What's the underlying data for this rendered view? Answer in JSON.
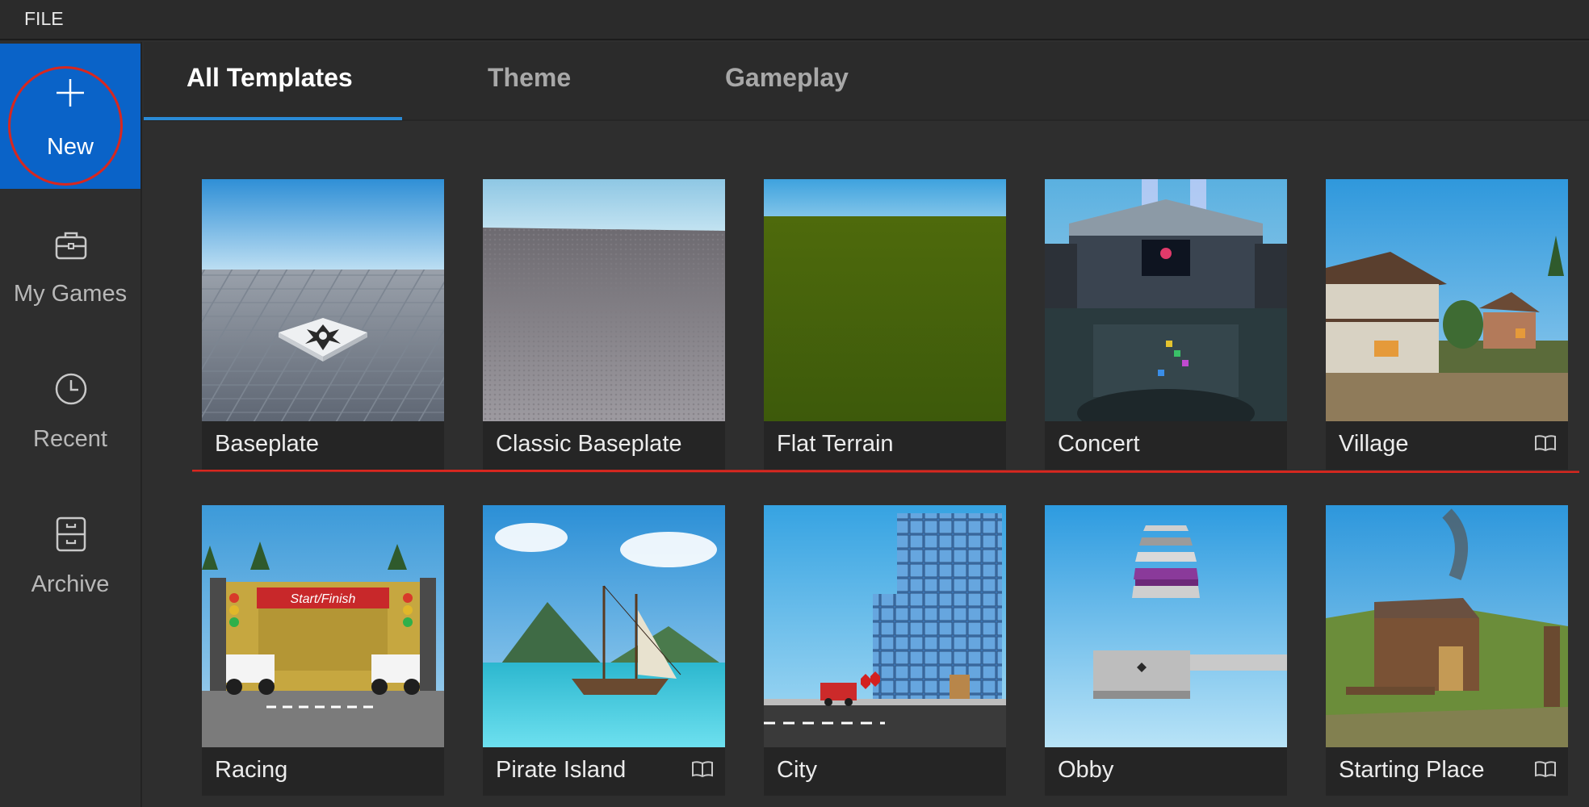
{
  "menubar": {
    "file_label": "FILE"
  },
  "sidebar": {
    "items": [
      {
        "label": "New",
        "icon": "plus-icon",
        "selected": true
      },
      {
        "label": "My Games",
        "icon": "briefcase-icon"
      },
      {
        "label": "Recent",
        "icon": "clock-icon"
      },
      {
        "label": "Archive",
        "icon": "archive-icon"
      }
    ]
  },
  "tabs": [
    {
      "label": "All Templates",
      "active": true
    },
    {
      "label": "Theme",
      "active": false
    },
    {
      "label": "Gameplay",
      "active": false
    }
  ],
  "templates": [
    {
      "title": "Baseplate",
      "tutorial": false
    },
    {
      "title": "Classic Baseplate",
      "tutorial": false
    },
    {
      "title": "Flat Terrain",
      "tutorial": false
    },
    {
      "title": "Concert",
      "tutorial": false
    },
    {
      "title": "Village",
      "tutorial": true
    },
    {
      "title": "Racing",
      "tutorial": false
    },
    {
      "title": "Pirate Island",
      "tutorial": true
    },
    {
      "title": "City",
      "tutorial": false
    },
    {
      "title": "Obby",
      "tutorial": false
    },
    {
      "title": "Starting Place",
      "tutorial": true
    }
  ],
  "racing_banner": "Start/Finish",
  "colors": {
    "accent_blue": "#0a63c8",
    "tab_underline": "#2a8bd6",
    "annotation_red": "#d8271f",
    "background": "#2e2e2e"
  }
}
